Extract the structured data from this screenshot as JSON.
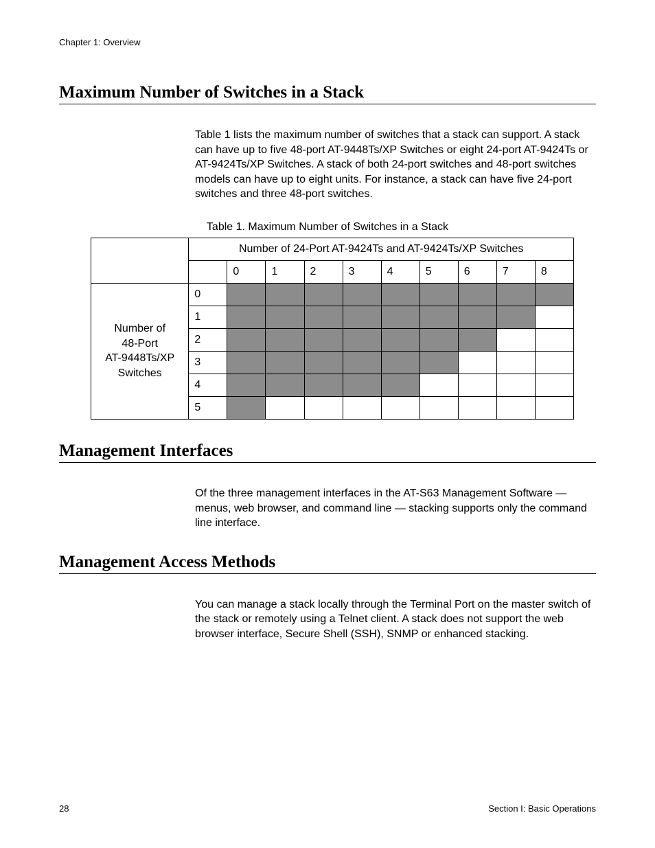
{
  "header": {
    "chapter": "Chapter 1: Overview"
  },
  "section1": {
    "title": "Maximum Number of Switches in a Stack",
    "paragraph": "Table 1 lists the maximum number of switches that a stack can support. A stack can have up to five 48-port AT-9448Ts/XP Switches or eight 24-port AT-9424Ts or AT-9424Ts/XP Switches. A stack of both 24-port switches and 48-port switches models can have up to eight units. For instance, a stack can have five 24-port switches and three 48-port switches."
  },
  "table": {
    "caption": "Table 1. Maximum Number of Switches in a Stack",
    "top_header": "Number of 24-Port AT-9424Ts and AT-9424Ts/XP Switches",
    "side_header_line1": "Number of",
    "side_header_line2": "48-Port",
    "side_header_line3": "AT-9448Ts/XP",
    "side_header_line4": "Switches",
    "cols": [
      "0",
      "1",
      "2",
      "3",
      "4",
      "5",
      "6",
      "7",
      "8"
    ],
    "rows": [
      "0",
      "1",
      "2",
      "3",
      "4",
      "5"
    ],
    "shaded": {
      "0": [
        true,
        true,
        true,
        true,
        true,
        true,
        true,
        true,
        true
      ],
      "1": [
        true,
        true,
        true,
        true,
        true,
        true,
        true,
        true,
        false
      ],
      "2": [
        true,
        true,
        true,
        true,
        true,
        true,
        true,
        false,
        false
      ],
      "3": [
        true,
        true,
        true,
        true,
        true,
        true,
        false,
        false,
        false
      ],
      "4": [
        true,
        true,
        true,
        true,
        true,
        false,
        false,
        false,
        false
      ],
      "5": [
        true,
        false,
        false,
        false,
        false,
        false,
        false,
        false,
        false
      ]
    }
  },
  "section2": {
    "title": "Management Interfaces",
    "paragraph": "Of the three management interfaces in the AT-S63 Management Software — menus, web browser, and command line — stacking supports only the command line interface."
  },
  "section3": {
    "title": "Management Access Methods",
    "paragraph": "You can manage a stack locally through the Terminal Port on the master switch of the stack or remotely using a Telnet client. A stack does not support the web browser interface, Secure Shell (SSH), SNMP or enhanced stacking."
  },
  "footer": {
    "page": "28",
    "section": "Section I: Basic Operations"
  },
  "chart_data": {
    "type": "table",
    "title": "Table 1. Maximum Number of Switches in a Stack",
    "x_axis_label": "Number of 24-Port AT-9424Ts and AT-9424Ts/XP Switches",
    "y_axis_label": "Number of 48-Port AT-9448Ts/XP Switches",
    "x_categories": [
      0,
      1,
      2,
      3,
      4,
      5,
      6,
      7,
      8
    ],
    "y_categories": [
      0,
      1,
      2,
      3,
      4,
      5
    ],
    "valid_combinations": [
      [
        true,
        true,
        true,
        true,
        true,
        true,
        true,
        true,
        true
      ],
      [
        true,
        true,
        true,
        true,
        true,
        true,
        true,
        true,
        false
      ],
      [
        true,
        true,
        true,
        true,
        true,
        true,
        true,
        false,
        false
      ],
      [
        true,
        true,
        true,
        true,
        true,
        true,
        false,
        false,
        false
      ],
      [
        true,
        true,
        true,
        true,
        true,
        false,
        false,
        false,
        false
      ],
      [
        true,
        false,
        false,
        false,
        false,
        false,
        false,
        false,
        false
      ]
    ]
  }
}
